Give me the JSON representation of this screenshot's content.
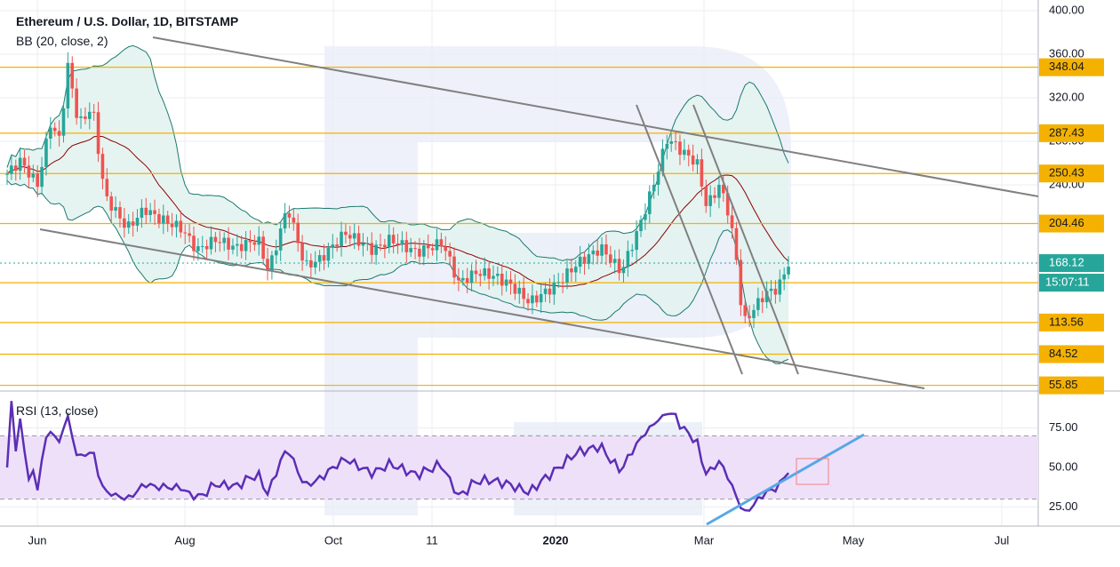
{
  "header": {
    "title": "Ethereum / U.S. Dollar, 1D, BITSTAMP",
    "bb_label": "BB (20, close, 2)",
    "rsi_label": "RSI (13, close)"
  },
  "chart_data": [
    {
      "type": "candlestick",
      "title": "Ethereum / U.S. Dollar, 1D, BITSTAMP",
      "indicator": "BB (20, close, 2)",
      "x_ticks": [
        "Jun",
        "Aug",
        "Oct",
        "11",
        "2020",
        "Mar",
        "May",
        "Jul"
      ],
      "y_ticks": [
        400,
        360,
        320,
        280,
        240
      ],
      "price_levels": [
        348.04,
        287.43,
        250.43,
        204.46,
        150.12,
        113.56,
        84.52,
        55.85
      ],
      "last_price": 168.12,
      "countdown": "15:07:11",
      "colors": {
        "up": "#26a69a",
        "down": "#ef5350",
        "level": "#f5b100",
        "bb_fill": "#e3f3ef",
        "bb_band": "#1b7a6e",
        "bb_basis": "#8b0000",
        "trend": "#808080",
        "last_price": "#26a69a"
      }
    },
    {
      "type": "line",
      "title": "RSI (13, close)",
      "y_ticks": [
        75,
        50,
        25
      ],
      "band": [
        30,
        70
      ],
      "colors": {
        "line": "#5b2fb5",
        "band_fill": "#efe0fa",
        "trend": "#56a8e8",
        "box": "#f08080"
      }
    }
  ]
}
